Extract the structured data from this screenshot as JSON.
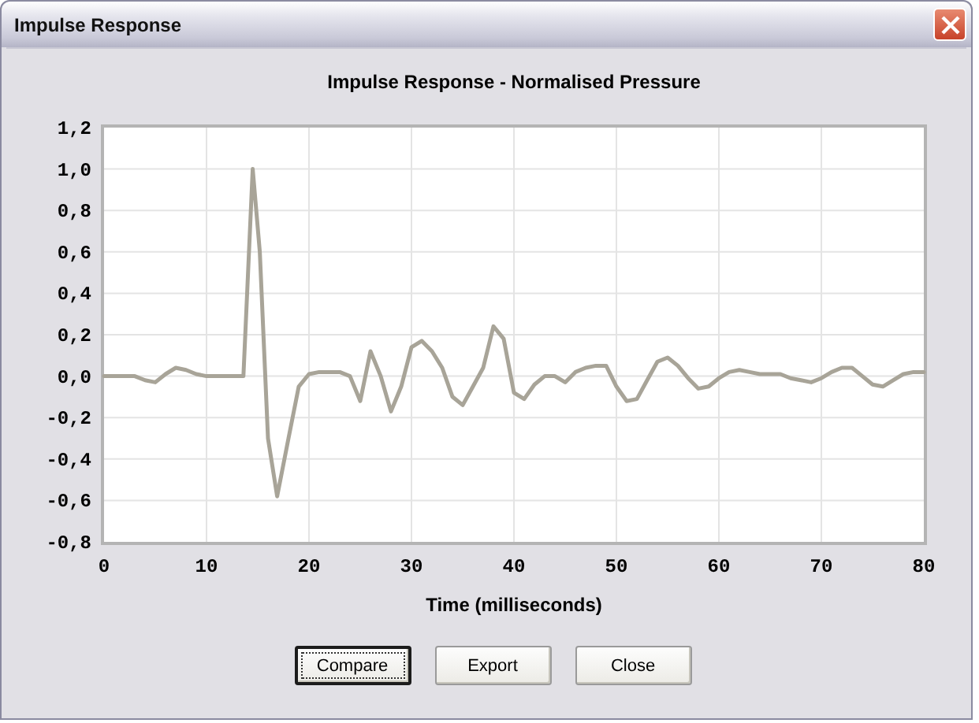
{
  "window": {
    "title": "Impulse Response"
  },
  "chart": {
    "chart_data": {
      "type": "line",
      "title": "Impulse Response - Normalised Pressure",
      "xlabel": "Time (milliseconds)",
      "x": [
        0,
        1,
        2,
        3,
        4,
        5,
        6,
        7,
        8,
        9,
        10,
        11,
        12,
        13,
        13.6,
        14.5,
        15.2,
        16,
        16.9,
        18,
        19,
        20,
        21,
        22,
        23,
        24,
        25,
        26,
        27,
        28,
        29,
        30,
        31,
        32,
        33,
        34,
        35,
        36,
        37,
        38,
        39,
        40,
        41,
        42,
        43,
        44,
        45,
        46,
        47,
        48,
        49,
        50,
        51,
        52,
        53,
        54,
        55,
        56,
        57,
        58,
        59,
        60,
        61,
        62,
        63,
        64,
        65,
        66,
        67,
        68,
        69,
        70,
        71,
        72,
        73,
        74,
        75,
        76,
        77,
        78,
        79,
        80
      ],
      "grid": true,
      "series": [
        {
          "color": "#a8a498",
          "values": [
            0,
            0,
            0,
            0,
            -0.02,
            -0.03,
            0.01,
            0.04,
            0.03,
            0.01,
            0,
            0,
            0,
            0,
            0,
            1.0,
            0.6,
            -0.3,
            -0.58,
            -0.3,
            -0.05,
            0.01,
            0.02,
            0.02,
            0.02,
            0.0,
            -0.12,
            0.12,
            0.0,
            -0.17,
            -0.05,
            0.14,
            0.17,
            0.12,
            0.04,
            -0.1,
            -0.14,
            -0.05,
            0.04,
            0.24,
            0.18,
            -0.08,
            -0.11,
            -0.04,
            0.0,
            0.0,
            -0.03,
            0.02,
            0.04,
            0.05,
            0.05,
            -0.05,
            -0.12,
            -0.11,
            -0.02,
            0.07,
            0.09,
            0.05,
            -0.01,
            -0.06,
            -0.05,
            -0.01,
            0.02,
            0.03,
            0.02,
            0.01,
            0.01,
            0.01,
            -0.01,
            -0.02,
            -0.03,
            -0.01,
            0.02,
            0.04,
            0.04,
            0.0,
            -0.04,
            -0.05,
            -0.02,
            0.01,
            0.02,
            0.02
          ]
        }
      ],
      "xlim": [
        0,
        80
      ],
      "ylim": [
        -0.8,
        1.2
      ],
      "xticks": [
        0,
        10,
        20,
        30,
        40,
        50,
        60,
        70,
        80
      ],
      "yticks": [
        {
          "value": 1.2,
          "label": "1,2"
        },
        {
          "value": 1.0,
          "label": "1,0"
        },
        {
          "value": 0.8,
          "label": "0,8"
        },
        {
          "value": 0.6,
          "label": "0,6"
        },
        {
          "value": 0.4,
          "label": "0,4"
        },
        {
          "value": 0.2,
          "label": "0,2"
        },
        {
          "value": 0,
          "label": "0,0"
        },
        {
          "value": -0.2,
          "label": "-0,2"
        },
        {
          "value": -0.4,
          "label": "-0,4"
        },
        {
          "value": -0.6,
          "label": "-0,6"
        },
        {
          "value": -0.8,
          "label": "-0,8"
        }
      ]
    }
  },
  "buttons": [
    {
      "label": "Compare",
      "focused": true
    },
    {
      "label": "Export",
      "focused": false
    },
    {
      "label": "Close",
      "focused": false
    }
  ]
}
